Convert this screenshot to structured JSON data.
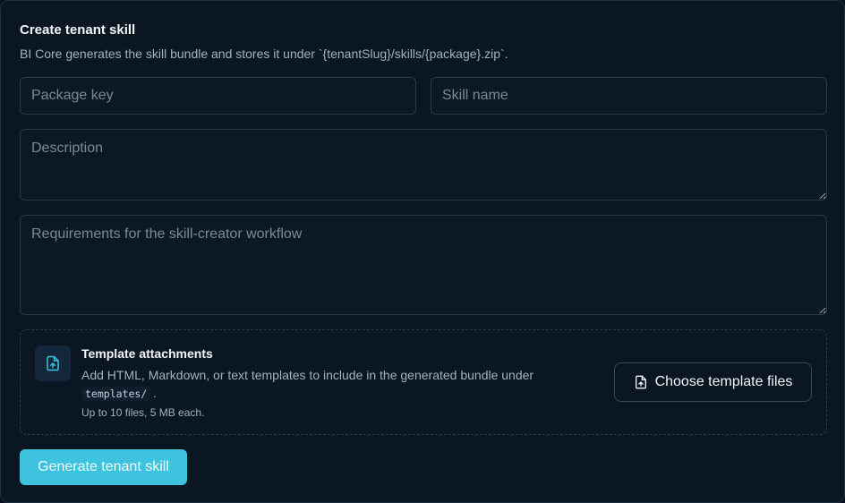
{
  "form": {
    "title": "Create tenant skill",
    "subtitle": "BI Core generates the skill bundle and stores it under `{tenantSlug}/skills/{package}.zip`.",
    "package_key": {
      "placeholder": "Package key",
      "value": ""
    },
    "skill_name": {
      "placeholder": "Skill name",
      "value": ""
    },
    "description": {
      "placeholder": "Description",
      "value": ""
    },
    "requirements": {
      "placeholder": "Requirements for the skill-creator workflow",
      "value": ""
    }
  },
  "attachments": {
    "title": "Template attachments",
    "description": "Add HTML, Markdown, or text templates to include in the generated bundle under",
    "path": "templates/",
    "period": ".",
    "limit": "Up to 10 files, 5 MB each.",
    "choose_label": "Choose template files",
    "icon": "file-upload-icon"
  },
  "actions": {
    "generate_label": "Generate tenant skill"
  },
  "colors": {
    "accent": "#3ec3de",
    "background": "#0b1623",
    "border": "#2b3a49"
  }
}
